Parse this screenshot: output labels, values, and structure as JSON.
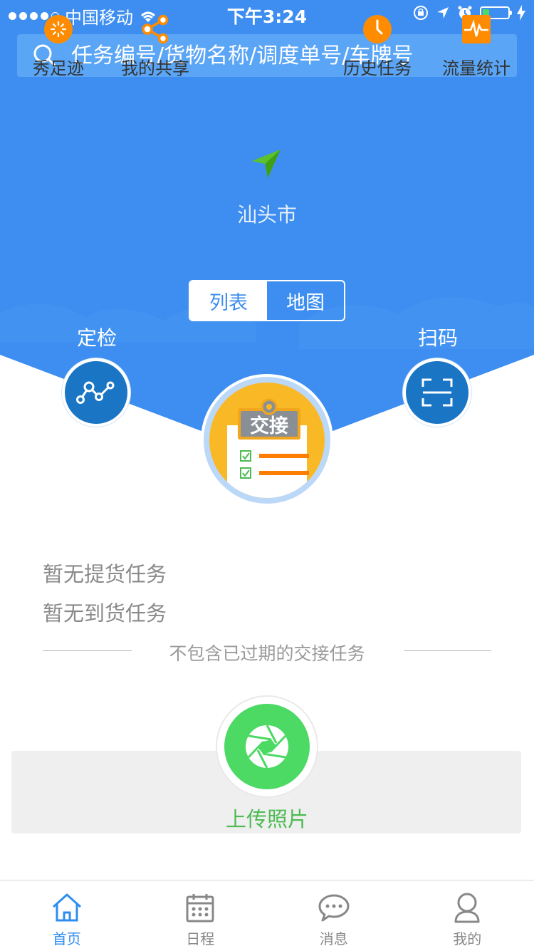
{
  "status_bar": {
    "carrier": "中国移动",
    "time": "下午3:24"
  },
  "search": {
    "placeholder": "任务编号/货物名称/调度单号/车牌号"
  },
  "location": {
    "city": "汕头市"
  },
  "view_toggle": {
    "list_label": "列表",
    "map_label": "地图",
    "selected": "列表"
  },
  "actions": {
    "inspect_label": "定检",
    "scan_label": "扫码",
    "handover_label": "交接"
  },
  "tasks": {
    "pickup_status": "暂无提货任务",
    "arrival_status": "暂无到货任务",
    "note": "不包含已过期的交接任务"
  },
  "toolbar": {
    "items": [
      {
        "label": "秀足迹",
        "icon": "footprint-icon"
      },
      {
        "label": "我的共享",
        "icon": "share-icon"
      },
      {
        "label": "上传照片",
        "icon": "camera-shutter-icon"
      },
      {
        "label": "历史任务",
        "icon": "clock-icon"
      },
      {
        "label": "流量统计",
        "icon": "pulse-icon"
      }
    ]
  },
  "tabbar": {
    "items": [
      {
        "label": "首页",
        "icon": "home-icon",
        "active": true
      },
      {
        "label": "日程",
        "icon": "calendar-icon",
        "active": false
      },
      {
        "label": "消息",
        "icon": "chat-icon",
        "active": false
      },
      {
        "label": "我的",
        "icon": "user-icon",
        "active": false
      }
    ]
  },
  "colors": {
    "primary_blue": "#3d8ef0",
    "dark_blue": "#1a76c5",
    "accent_orange": "#ff8c00",
    "accent_green": "#4cd964",
    "handover_yellow": "#f9b826"
  }
}
